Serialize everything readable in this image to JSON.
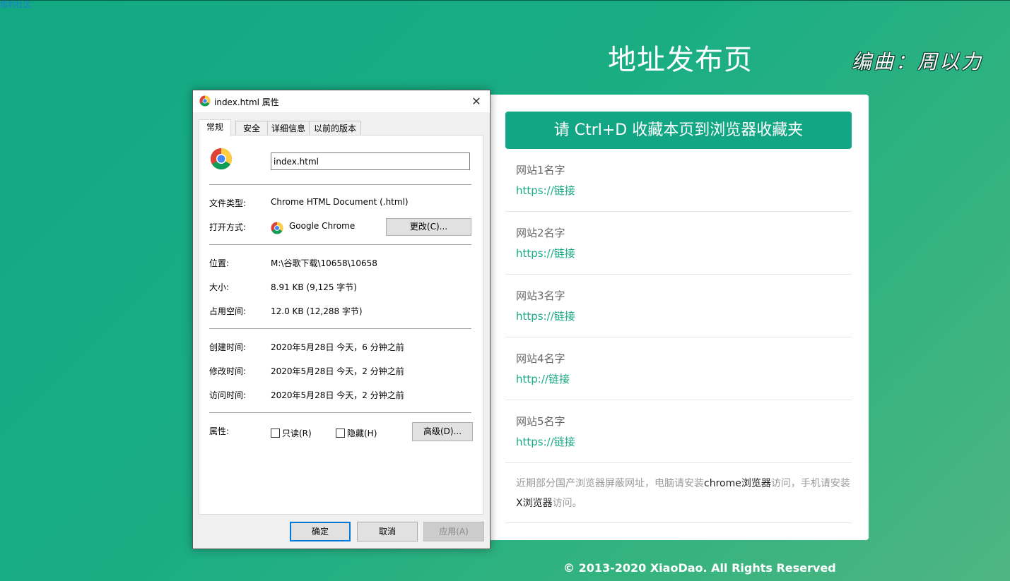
{
  "top_link": "猎豹社区",
  "page": {
    "title": "地址发布页",
    "editor": "编曲：周以力",
    "favorite_banner": "请 Ctrl+D 收藏本页到浏览器收藏夹",
    "sites": [
      {
        "name": "网站1名字",
        "link": "https://链接"
      },
      {
        "name": "网站2名字",
        "link": "https://链接"
      },
      {
        "name": "网站3名字",
        "link": "https://链接"
      },
      {
        "name": "网站4名字",
        "link": "http://链接"
      },
      {
        "name": "网站5名字",
        "link": "https://链接"
      }
    ],
    "notice": {
      "part1": "近期部分国产浏览器屏蔽网址，电脑请安装",
      "chrome": "chrome浏览器",
      "part2": "访问，手机请安装",
      "x": "X浏览器",
      "part3": "访问。"
    },
    "copyright": "© 2013-2020 XiaoDao. All Rights Reserved"
  },
  "dialog": {
    "title": "index.html 属性",
    "close_glyph": "✕",
    "tabs": [
      "常规",
      "安全",
      "详细信息",
      "以前的版本"
    ],
    "filename": "index.html",
    "file_type_label": "文件类型:",
    "file_type": "Chrome HTML Document (.html)",
    "open_with_label": "打开方式:",
    "open_with": "Google Chrome",
    "change_button": "更改(C)...",
    "location_label": "位置:",
    "location": "M:\\谷歌下载\\10658\\10658",
    "size_label": "大小:",
    "size": "8.91 KB (9,125 字节)",
    "disk_size_label": "占用空间:",
    "disk_size": "12.0 KB (12,288 字节)",
    "created_label": "创建时间:",
    "created": "2020年5月28日 今天，6 分钟之前",
    "modified_label": "修改时间:",
    "modified": "2020年5月28日 今天，2 分钟之前",
    "accessed_label": "访问时间:",
    "accessed": "2020年5月28日 今天，2 分钟之前",
    "attributes_label": "属性:",
    "readonly": "只读(R)",
    "hidden": "隐藏(H)",
    "advanced_button": "高级(D)...",
    "ok_button": "确定",
    "cancel_button": "取消",
    "apply_button": "应用(A)"
  },
  "colors": {
    "accent": "#13a684",
    "link": "#1aaa85",
    "dialog_focus": "#0078d7"
  },
  "icons": {
    "app_icon": "chrome-icon"
  }
}
